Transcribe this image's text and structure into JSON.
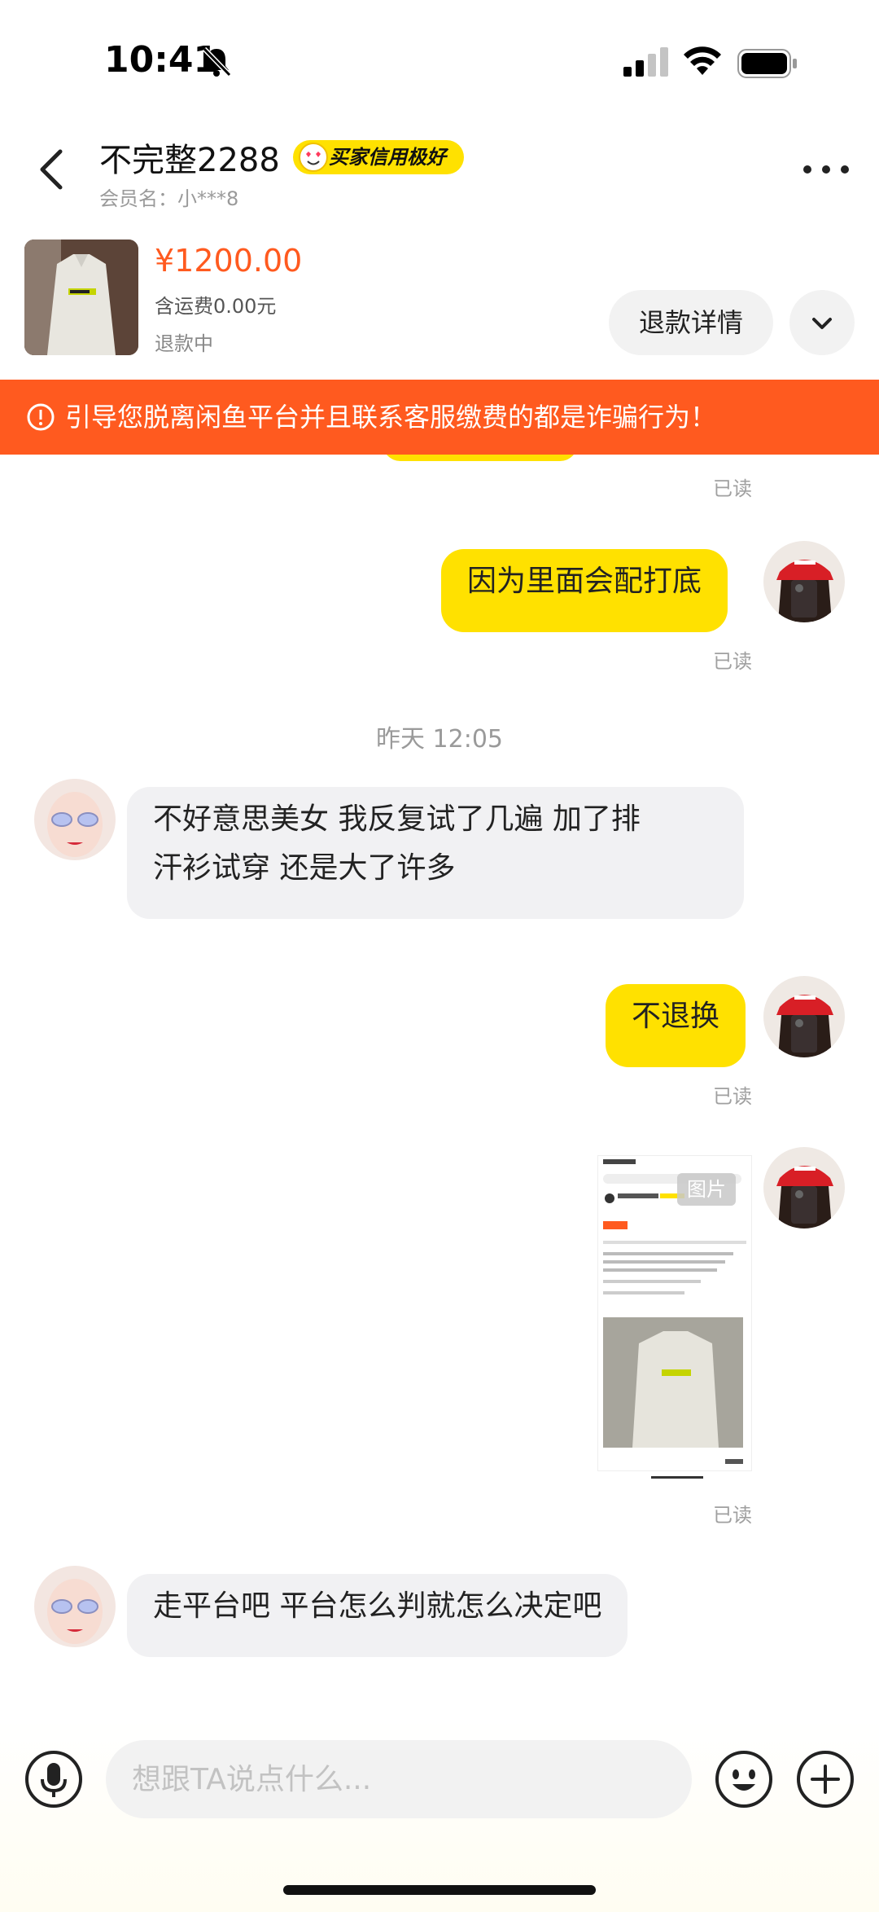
{
  "status": {
    "time": "10:41"
  },
  "header": {
    "title": "不完整2288",
    "badge": "买家信用极好",
    "member": "会员名：小***8"
  },
  "product": {
    "price": "¥1200.00",
    "shipping": "含运费0.00元",
    "state": "退款中",
    "detail_button": "退款详情"
  },
  "warning": "引导您脱离闲鱼平台并且联系客服缴费的都是诈骗行为！",
  "chat": {
    "read1": "已读",
    "msg1": "因为里面会配打底",
    "read2": "已读",
    "timestamp": "昨天 12:05",
    "msg2_line1": "不好意思美女 我反复试了几遍 加了排",
    "msg2_line2": "汗衫试穿 还是大了许多",
    "msg3": "不退换",
    "read3": "已读",
    "image_tag": "图片",
    "read4": "已读",
    "msg4": "走平台吧 平台怎么判就怎么决定吧"
  },
  "input": {
    "placeholder": "想跟TA说点什么..."
  },
  "colors": {
    "accent": "#ffe100",
    "warning": "#ff5a1f",
    "price": "#ff5a1f"
  }
}
